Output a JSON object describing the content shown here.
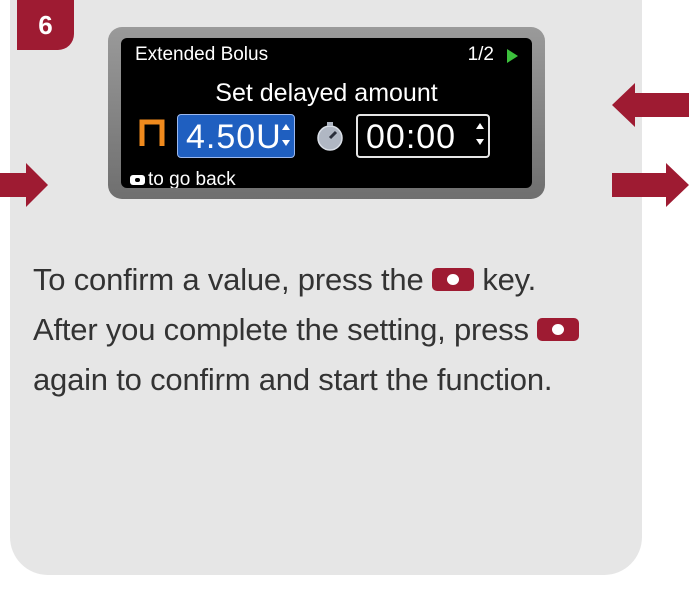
{
  "step": {
    "number": "6"
  },
  "screen": {
    "title": "Extended Bolus",
    "page": "1/2",
    "subtitle": "Set delayed amount",
    "amount": "4.50U",
    "time": "00:00",
    "back_hint": "to go back",
    "icons": [
      "extended-bolus-icon",
      "stopwatch-icon",
      "key-icon",
      "next-page-arrow-icon"
    ]
  },
  "instructions": {
    "line1_before": "To confirm a value, press the",
    "line1_after": "key.",
    "line2_before": "After you complete the setting, press",
    "line3": "again to confirm and start the function."
  },
  "colors": {
    "accent": "#9e1b32",
    "selection_blue": "#1f5fc0",
    "bolus_orange": "#f08a1d",
    "page_arrow_green": "#3cc03c",
    "card_bg": "#e6e6e6"
  }
}
